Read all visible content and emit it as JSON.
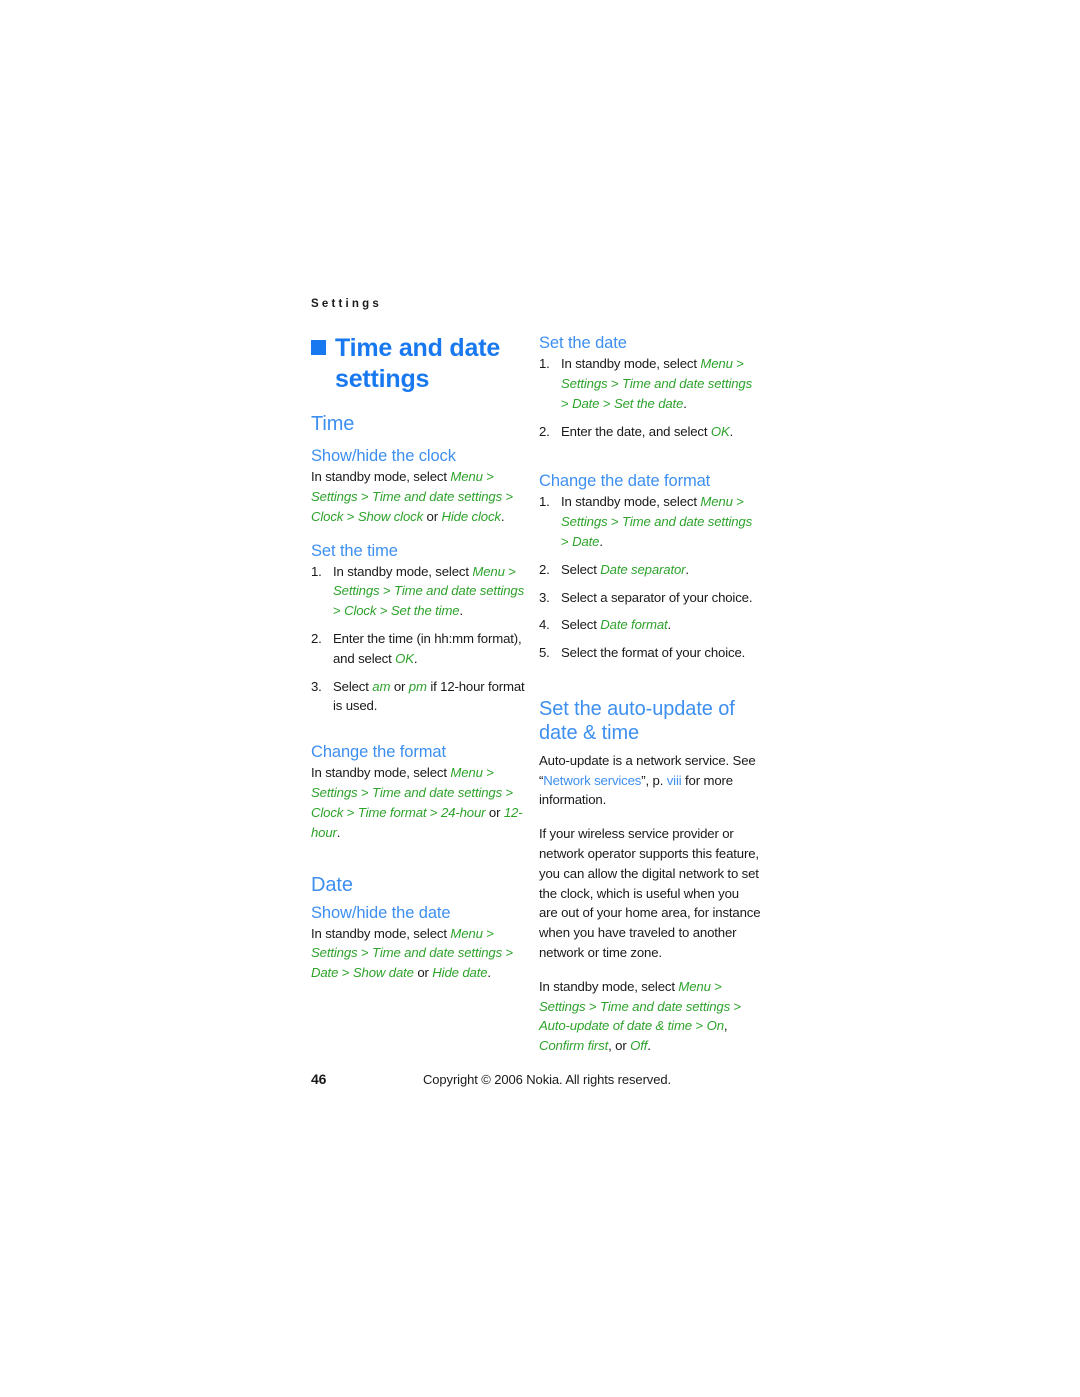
{
  "running_header": "Settings",
  "chapter": {
    "title": "Time and date settings",
    "marker": "square-bullet"
  },
  "colors": {
    "heading_blue": "#3d8ff0",
    "title_blue": "#1878f0",
    "menu_green": "#2ea32c",
    "body_black": "#1a1a1a",
    "page_background": "#ffffff"
  },
  "left_column": {
    "section_time": "Time",
    "show_hide_clock": {
      "heading": "Show/hide the clock",
      "lead": "In standby mode, select ",
      "menu_1": "Menu",
      "sep_1": " > ",
      "menu_2": "Settings",
      "sep_2": " > ",
      "menu_3": "Time and date settings",
      "sep_3": " > ",
      "menu_4": "Clock",
      "sep_4": " > ",
      "menu_5": "Show clock",
      "or_text": " or ",
      "menu_6": "Hide clock",
      "period": "."
    },
    "set_the_time": {
      "heading": "Set the time",
      "steps": [
        {
          "num": "1.",
          "lead": "In standby mode, select ",
          "menu_1": "Menu",
          "sep_1": " > ",
          "menu_2": "Settings",
          "sep_2": " > ",
          "menu_3": "Time and date settings",
          "sep_3": " > ",
          "menu_4": "Clock",
          "sep_4": " > ",
          "menu_5": "Set the time",
          "period": "."
        },
        {
          "num": "2.",
          "lead": "Enter the time (in hh:mm format), and select ",
          "menu_1": "OK",
          "period": "."
        },
        {
          "num": "3.",
          "lead": "Select ",
          "menu_1": "am",
          "mid": " or ",
          "menu_2": "pm",
          "tail": " if 12-hour format is used."
        }
      ]
    },
    "change_the_format": {
      "heading": "Change the format",
      "lead": "In standby mode, select ",
      "menu_1": "Menu",
      "sep_1": " > ",
      "menu_2": "Settings",
      "sep_2": " > ",
      "menu_3": "Time and date settings",
      "sep_3": " > ",
      "menu_4": "Clock",
      "sep_4": " > ",
      "menu_5": "Time format",
      "sep_5": " > ",
      "menu_6": "24-hour",
      "or_text": " or ",
      "menu_7": "12-hour",
      "period": "."
    },
    "section_date": "Date",
    "show_hide_date": {
      "heading": "Show/hide the date",
      "lead": "In standby mode, select ",
      "menu_1": "Menu",
      "sep_1": " > ",
      "menu_2": "Settings",
      "sep_2": " > ",
      "menu_3": "Time and date settings",
      "sep_3": " > ",
      "menu_4": "Date",
      "sep_4": " > ",
      "menu_5": "Show date",
      "or_text": " or ",
      "menu_6": "Hide date",
      "period": "."
    }
  },
  "right_column": {
    "set_the_date": {
      "heading": "Set the date",
      "steps": [
        {
          "num": "1.",
          "lead": "In standby mode, select ",
          "menu_1": "Menu",
          "sep_1": " > ",
          "menu_2": "Settings",
          "sep_2": " > ",
          "menu_3": "Time and date settings",
          "sep_3": " > ",
          "menu_4": "Date",
          "sep_4": " > ",
          "menu_5": "Set the date",
          "period": "."
        },
        {
          "num": "2.",
          "lead": "Enter the date, and select ",
          "menu_1": "OK",
          "period": "."
        }
      ]
    },
    "change_the_date_format": {
      "heading": "Change the date format",
      "steps": [
        {
          "num": "1.",
          "lead": "In standby mode, select ",
          "menu_1": "Menu",
          "sep_1": " > ",
          "menu_2": "Settings",
          "sep_2": " > ",
          "menu_3": "Time and date settings",
          "sep_3": " > ",
          "menu_4": "Date",
          "period": "."
        },
        {
          "num": "2.",
          "lead": "Select ",
          "menu_1": "Date separator",
          "period": "."
        },
        {
          "num": "3.",
          "lead": "Select a separator of your choice."
        },
        {
          "num": "4.",
          "lead": "Select ",
          "menu_1": "Date format",
          "period": "."
        },
        {
          "num": "5.",
          "lead": "Select the format of your choice."
        }
      ]
    },
    "auto_update": {
      "heading": "Set the auto-update of date & time",
      "para_1_a": "Auto-update is a network service. See “",
      "link_1": "Network services",
      "para_1_b": "”, p. ",
      "link_2": "viii",
      "para_1_c": " for more information.",
      "para_2": "If your wireless service provider or network operator supports this feature, you can allow the digital network to set the clock, which is useful when you are out of your home area, for instance when you have traveled to another network or time zone.",
      "path": {
        "lead": "In standby mode, select ",
        "menu_1": "Menu",
        "sep_1": " > ",
        "menu_2": "Settings",
        "sep_2": " > ",
        "menu_3": "Time and date settings",
        "sep_3": " > ",
        "menu_4": "Auto-update of date & time",
        "sep_4": " > ",
        "menu_5": "On",
        "comma": ", ",
        "menu_6": "Confirm first",
        "or_text": ", or ",
        "menu_7": "Off",
        "period": "."
      }
    }
  },
  "footer": {
    "page_number": "46",
    "copyright": "Copyright © 2006 Nokia. All rights reserved."
  }
}
